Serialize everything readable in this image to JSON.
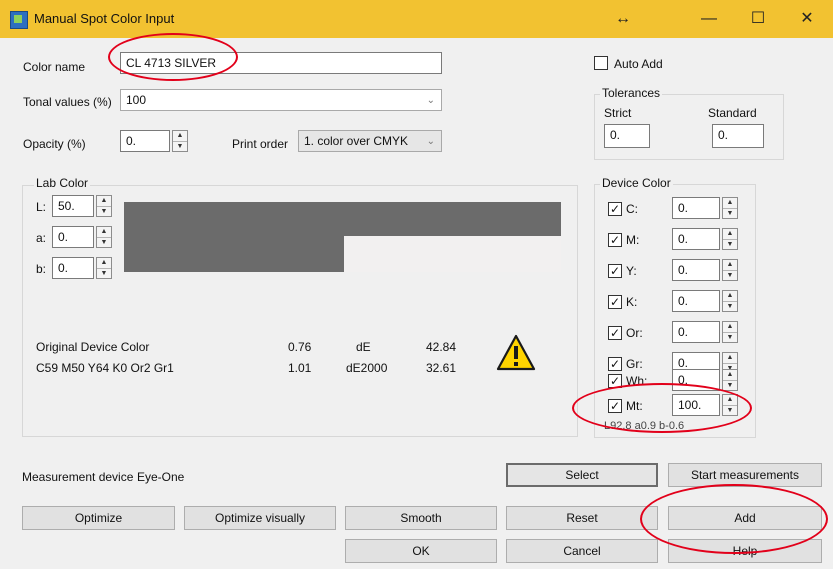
{
  "window": {
    "title": "Manual Spot Color Input",
    "extra_icon": "↔",
    "minimize": "—",
    "maximize": "☐",
    "close": "✕"
  },
  "color_name": {
    "label": "Color name",
    "value": "CL 4713 SILVER"
  },
  "tonal": {
    "label": "Tonal values (%)",
    "value": "100"
  },
  "opacity": {
    "label": "Opacity (%)",
    "value": "0."
  },
  "print_order": {
    "label": "Print order",
    "value": "1. color over CMYK"
  },
  "auto_add": {
    "label": "Auto Add",
    "checked": false
  },
  "tolerances": {
    "title": "Tolerances",
    "strict_label": "Strict",
    "standard_label": "Standard",
    "strict_value": "0.",
    "standard_value": "0."
  },
  "lab": {
    "title": "Lab Color",
    "l_label": "L:",
    "l_value": "50.",
    "a_label": "a:",
    "a_value": "0.",
    "b_label": "b:",
    "b_value": "0.",
    "swatch_top": "#6b6b6b",
    "swatch_bottom_right": "#f2f0f0"
  },
  "original": {
    "label": "Original Device Color",
    "spec": "C59 M50 Y64 K0 Or2 Gr1",
    "v1": "0.76",
    "v2": "1.01",
    "de_label": "dE",
    "de2000_label": "dE2000",
    "de_value": "42.84",
    "de2000_value": "32.61"
  },
  "device": {
    "title": "Device Color",
    "channels": [
      {
        "label": "C:",
        "value": "0."
      },
      {
        "label": "M:",
        "value": "0."
      },
      {
        "label": "Y:",
        "value": "0."
      },
      {
        "label": "K:",
        "value": "0."
      },
      {
        "label": "Or:",
        "value": "0."
      },
      {
        "label": "Gr:",
        "value": "0."
      },
      {
        "label": "Wh:",
        "value": "0."
      },
      {
        "label": "Mt:",
        "value": "100."
      }
    ],
    "lab_readout": "L92.8 a0.9 b-0.6"
  },
  "measurement": {
    "label": "Measurement device",
    "value": "Eye-One"
  },
  "buttons": {
    "select": "Select",
    "start": "Start measurements",
    "optimize": "Optimize",
    "optimize_visually": "Optimize visually",
    "smooth": "Smooth",
    "reset": "Reset",
    "add": "Add",
    "ok": "OK",
    "cancel": "Cancel",
    "help": "Help"
  },
  "colors": {
    "title_bar": "#f2c231",
    "highlight": "#e2001a",
    "warning_yellow": "#ffd400"
  }
}
